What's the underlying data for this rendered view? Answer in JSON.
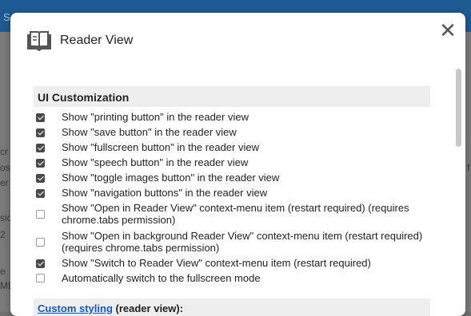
{
  "background": {
    "topbar_text": "S",
    "fragments": [
      "cr",
      "os",
      "er",
      "sio",
      "2",
      "e",
      "ME",
      "f"
    ]
  },
  "dialog": {
    "title": "Reader View",
    "close_glyph": "✕",
    "section_title": "UI Customization",
    "options": [
      {
        "label": "Show \"printing button\" in the reader view",
        "checked": true
      },
      {
        "label": "Show \"save button\" in the reader view",
        "checked": true
      },
      {
        "label": "Show \"fullscreen button\" in the reader view",
        "checked": true
      },
      {
        "label": "Show \"speech button\" in the reader view",
        "checked": true
      },
      {
        "label": "Show \"toggle images button\" in the reader view",
        "checked": true
      },
      {
        "label": "Show \"navigation buttons\" in the reader view",
        "checked": true
      },
      {
        "label": "Show \"Open in Reader View\" context-menu item (restart required) (requires chrome.tabs permission)",
        "checked": false
      },
      {
        "label": "Show \"Open in background Reader View\" context-menu item (restart required) (requires chrome.tabs permission)",
        "checked": false
      },
      {
        "label": "Show \"Switch to Reader View\" context-menu item (restart required)",
        "checked": true
      },
      {
        "label": "Automatically switch to the fullscreen mode",
        "checked": false
      }
    ],
    "custom_styling": {
      "link_text": "Custom styling",
      "suffix": " (reader view):"
    }
  }
}
